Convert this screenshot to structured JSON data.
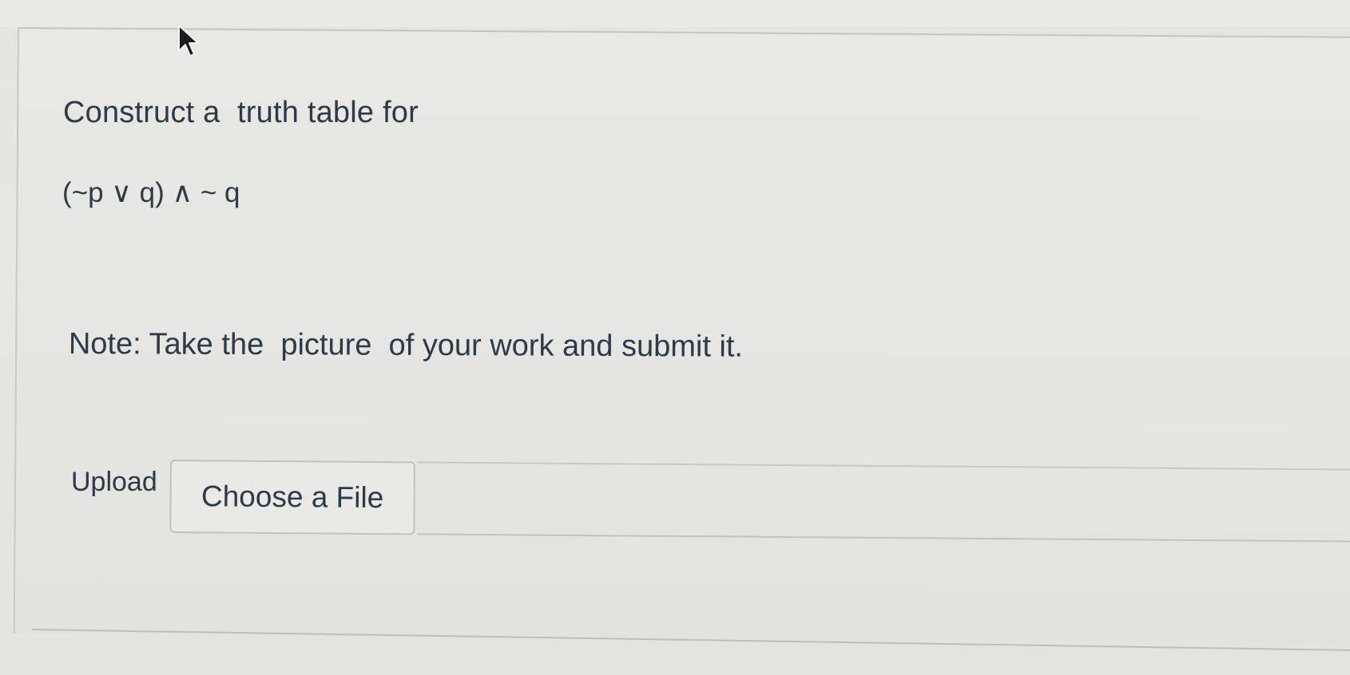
{
  "question": {
    "prompt": "Construct a  truth table for",
    "formula": "(~p ∨ q) ∧ ~ q",
    "note": "Note: Take the  picture  of your work and submit it."
  },
  "upload": {
    "label": "Upload",
    "button_label": "Choose a File"
  },
  "icons": {
    "cursor": "mouse-pointer-icon"
  }
}
